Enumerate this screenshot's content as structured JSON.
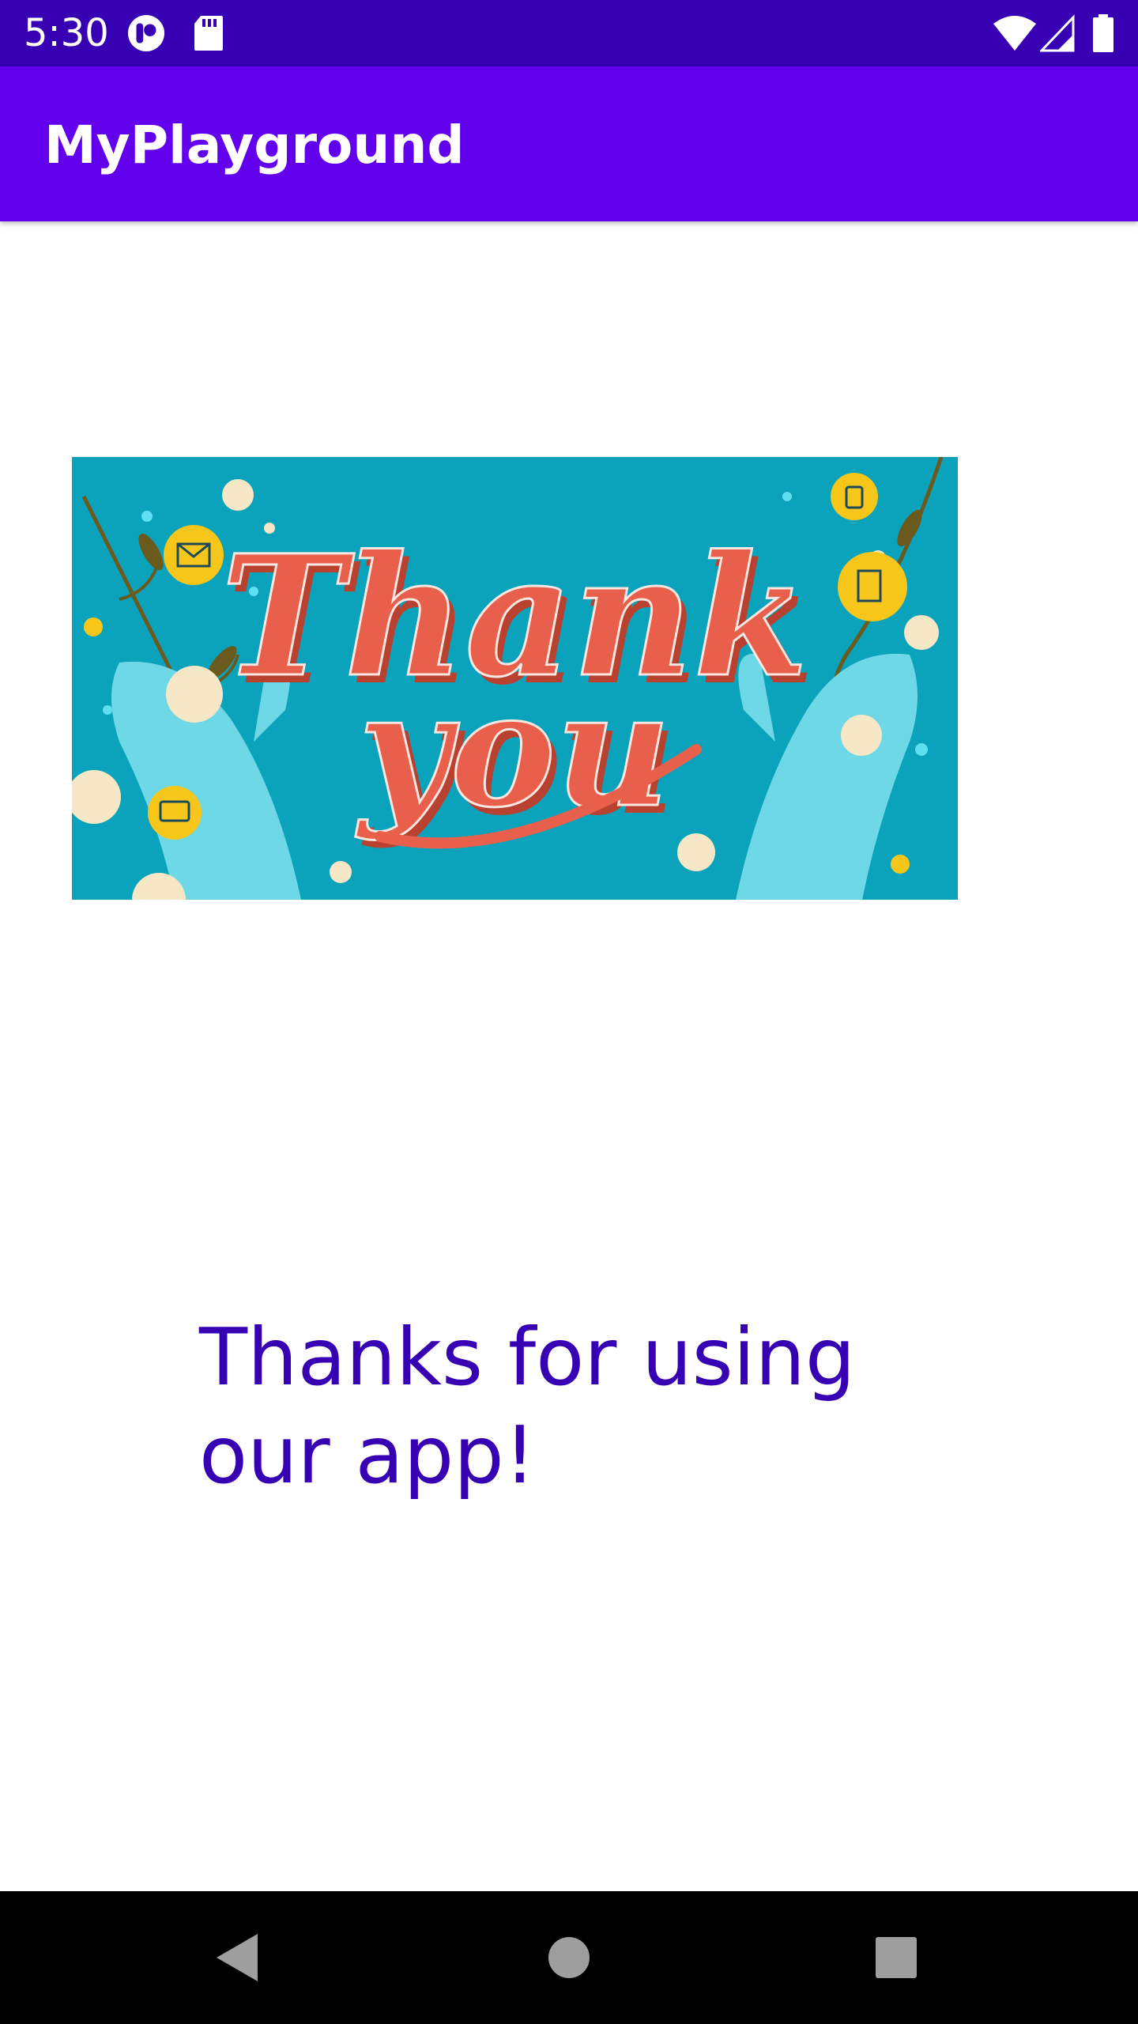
{
  "status_bar": {
    "time": "5:30",
    "icons": [
      "notification-app-icon",
      "sd-card-icon",
      "wifi-icon",
      "cell-signal-icon",
      "battery-icon"
    ]
  },
  "app_bar": {
    "title": "MyPlayground"
  },
  "banner": {
    "line1": "Thank",
    "line2": "you",
    "colors": {
      "background": "#0aa3bb",
      "lettering": "#e8604c",
      "hands": "#6fd8e6",
      "badges": "#f7c61b"
    }
  },
  "main": {
    "message": "Thanks for using our app!"
  },
  "nav_bar": {
    "buttons": [
      "back-icon",
      "home-icon",
      "recents-icon"
    ]
  },
  "colors": {
    "status_bar": "#3700b3",
    "app_bar": "#6200ee",
    "message_text": "#3700b3"
  }
}
